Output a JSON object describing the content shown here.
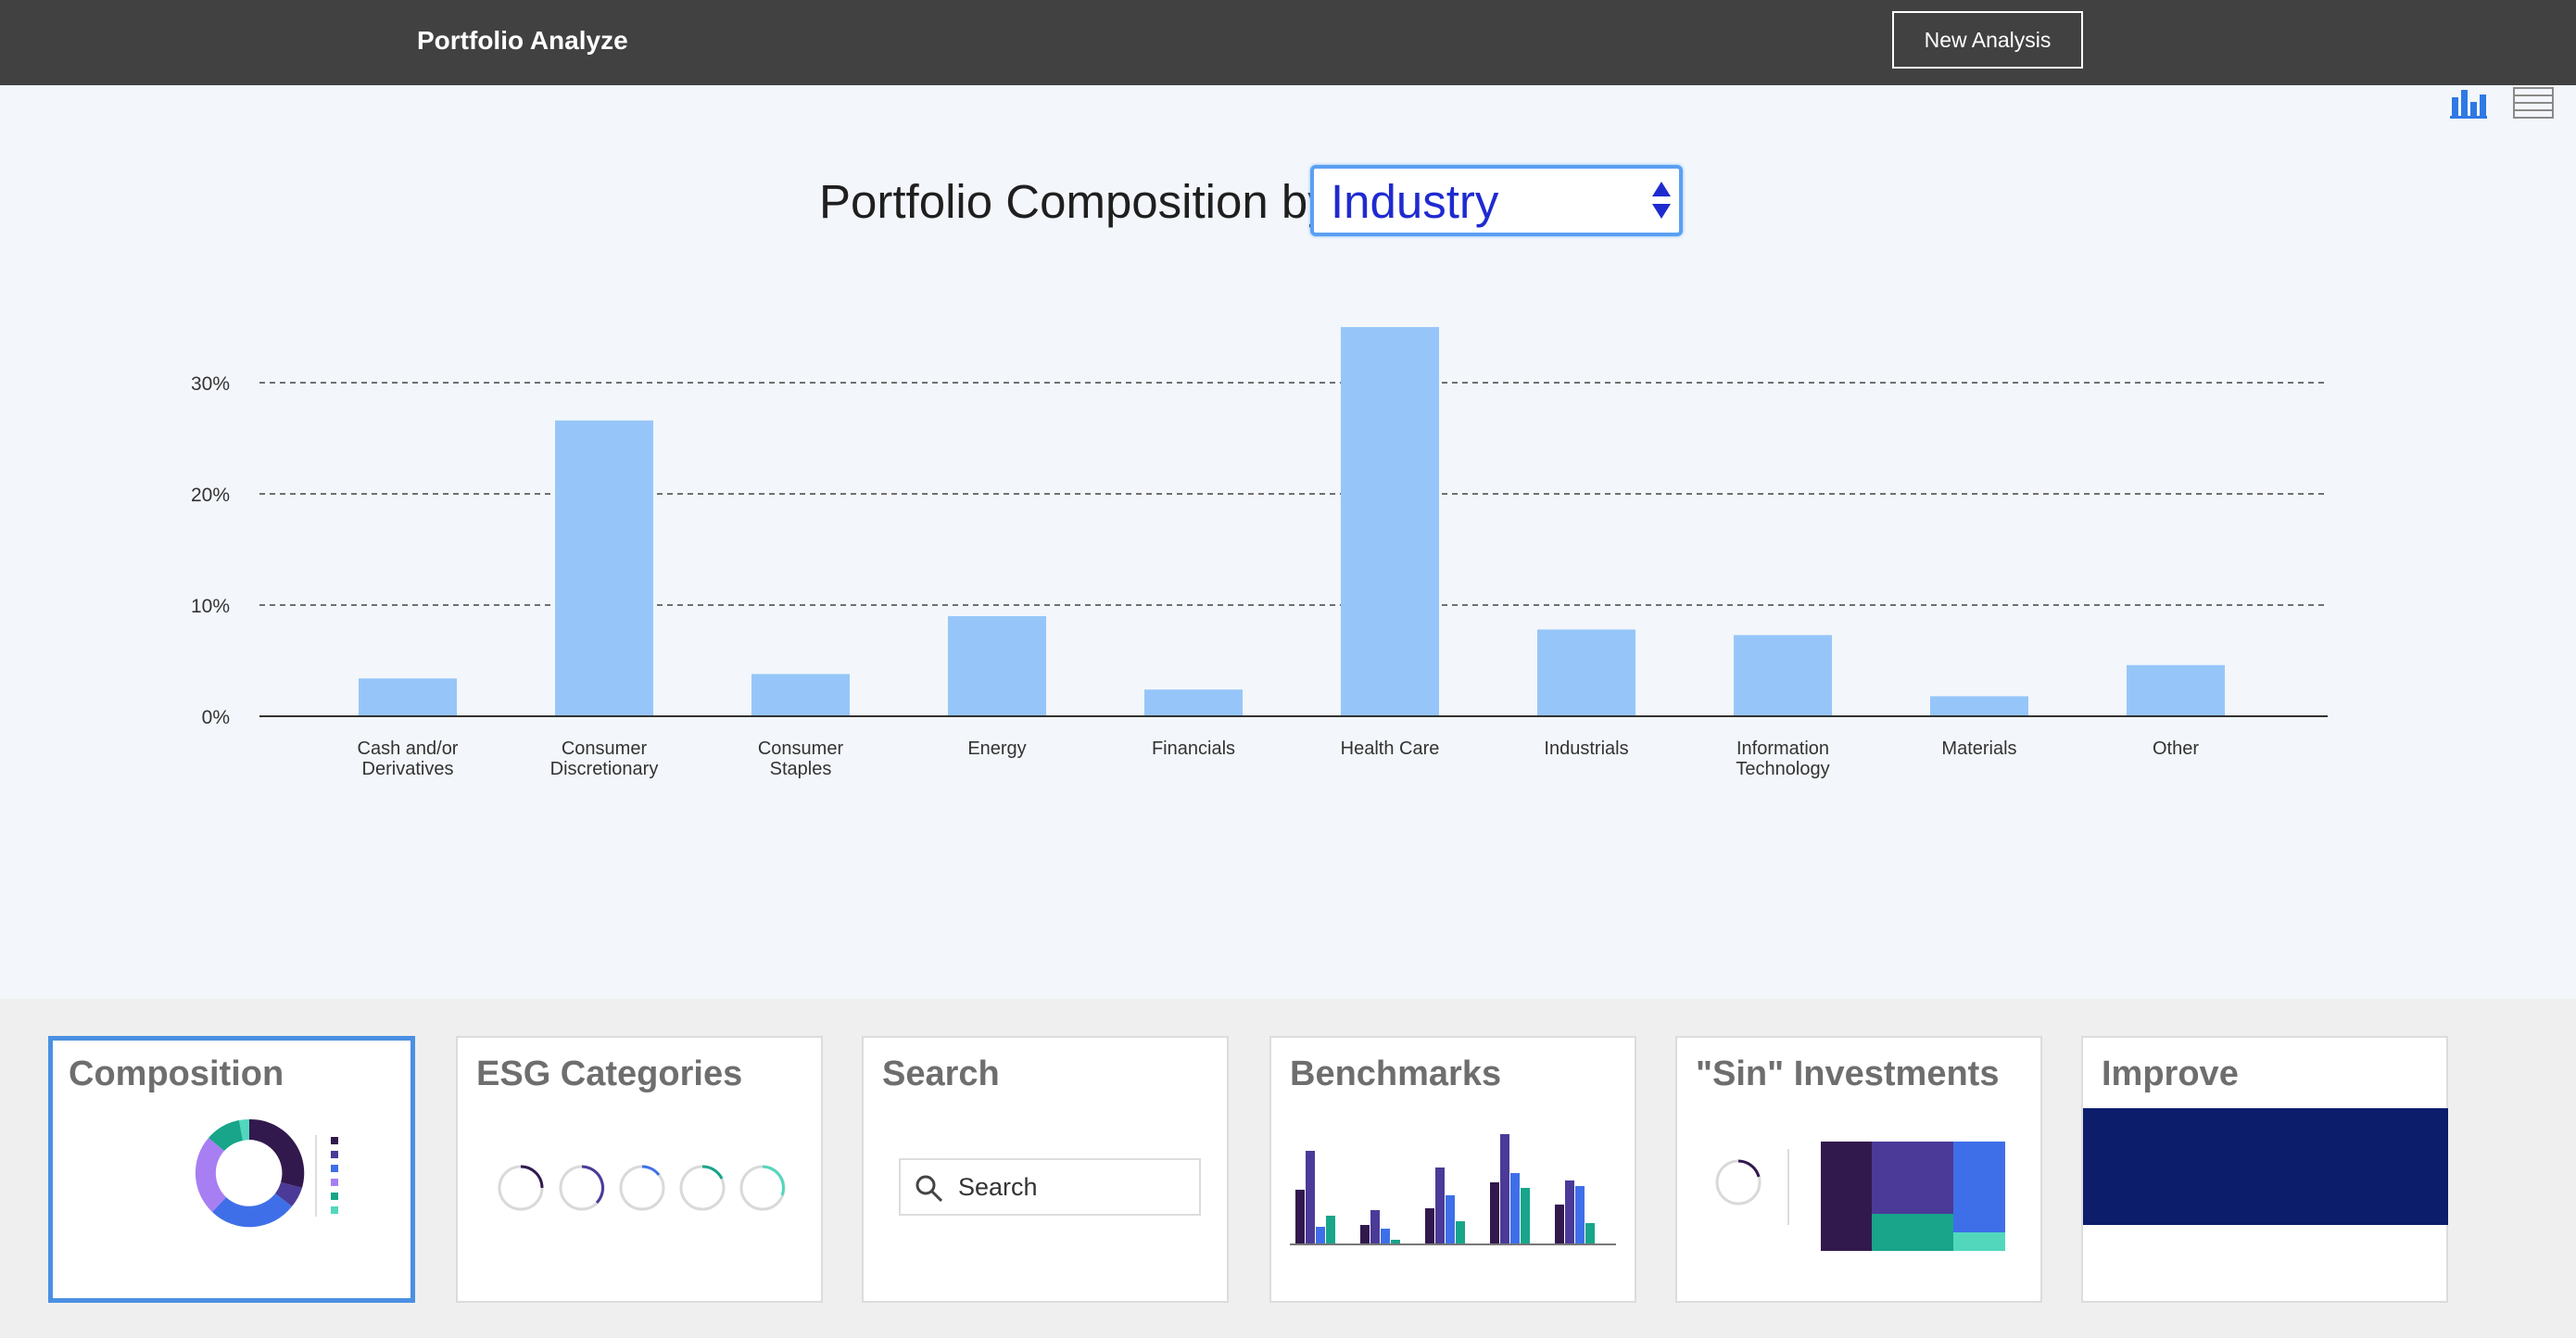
{
  "header": {
    "app_title": "Portfolio Analyze",
    "new_analysis_label": "New Analysis"
  },
  "view_toggle": {
    "chart_view_icon": "bar-chart-icon",
    "table_view_icon": "table-list-icon",
    "active": "chart"
  },
  "composition_headline": {
    "prefix": "Portfolio Composition by",
    "selected_dimension": "Industry"
  },
  "chart_data": {
    "type": "bar",
    "categories": [
      "Cash and/or Derivatives",
      "Consumer Discretionary",
      "Consumer Staples",
      "Energy",
      "Financials",
      "Health Care",
      "Industrials",
      "Information Technology",
      "Materials",
      "Other"
    ],
    "category_lines": [
      [
        "Cash and/or",
        "Derivatives"
      ],
      [
        "Consumer",
        "Discretionary"
      ],
      [
        "Consumer",
        "Staples"
      ],
      [
        "Energy"
      ],
      [
        "Financials"
      ],
      [
        "Health Care"
      ],
      [
        "Industrials"
      ],
      [
        "Information",
        "Technology"
      ],
      [
        "Materials"
      ],
      [
        "Other"
      ]
    ],
    "values": [
      3.4,
      26.6,
      3.8,
      9.0,
      2.4,
      35.0,
      7.8,
      7.3,
      1.8,
      4.6
    ],
    "y_ticks": [
      "0%",
      "10%",
      "20%",
      "30%"
    ],
    "y_tick_values": [
      0,
      10,
      20,
      30
    ],
    "ylim": [
      0,
      36
    ],
    "grid": "horizontal dashed",
    "bar_color": "#96c6f9",
    "title": "",
    "xlabel": "",
    "ylabel": ""
  },
  "cards": [
    {
      "title": "Composition",
      "selected": true,
      "preview": "donut-chart"
    },
    {
      "title": "ESG Categories",
      "selected": false,
      "preview": "loading-rings"
    },
    {
      "title": "Search",
      "selected": false,
      "preview": "search-field",
      "search_placeholder": "Search"
    },
    {
      "title": "Benchmarks",
      "selected": false,
      "preview": "grouped-bar-chart"
    },
    {
      "title": "\"Sin\" Investments",
      "selected": false,
      "preview": "treemap"
    },
    {
      "title": "Improve",
      "selected": false,
      "preview": "color-band"
    }
  ],
  "colors": {
    "topbar": "#414141",
    "accent_blue": "#4a90e2",
    "bar": "#96c6f9",
    "dark_purple": "#32194d",
    "indigo": "#4b3a98",
    "blue": "#3f6fe8",
    "teal": "#18a58a",
    "mint": "#52d7bd",
    "lavender": "#a77ff3",
    "navy": "#0c1d6c"
  }
}
